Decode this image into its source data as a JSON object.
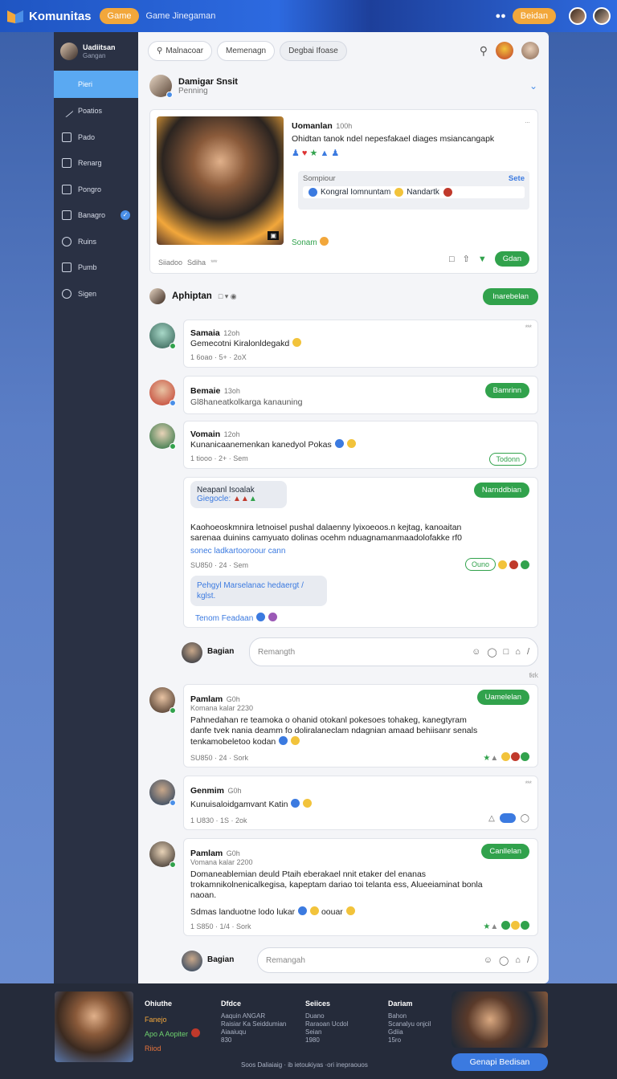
{
  "topbar": {
    "brand": "Komunitas",
    "game_pill": "Game",
    "link": "Game Jinegaman",
    "action_pill": "Beidan"
  },
  "sidebar": {
    "user_name": "Uadiitsan",
    "user_sub": "Gangan",
    "items": [
      {
        "label": "Pieri",
        "icon": "home-icon"
      },
      {
        "label": "Poatios",
        "icon": "pencil-icon"
      },
      {
        "label": "Pado",
        "icon": "document-icon"
      },
      {
        "label": "Renarg",
        "icon": "checkbox-icon"
      },
      {
        "label": "Pongro",
        "icon": "edit-icon"
      },
      {
        "label": "Banagro",
        "icon": "media-icon"
      },
      {
        "label": "Ruins",
        "icon": "group-icon"
      },
      {
        "label": "Pumb",
        "icon": "pen-icon"
      },
      {
        "label": "Sigen",
        "icon": "settings-icon"
      }
    ]
  },
  "main": {
    "search_label": "Malnacoar",
    "chip_1": "Memenagn",
    "chip_2": "Degbai Ifoase",
    "post": {
      "author": "Damigar Snsit",
      "sub": "Penning",
      "inner_author": "Uomanlan",
      "inner_time": "100h",
      "inner_text": "Ohidtan tanok ndel nepesfakael diages msiancangapk",
      "quote_label": "Sompiour",
      "quote_action": "Sete",
      "quote_text": "Kongral Iomnuntam",
      "quote_name": "Nandartk",
      "green_label": "Sonam",
      "stats": "Siiadoo",
      "stats_2": "Sdiha",
      "action_btn": "Gdan"
    },
    "section": {
      "title": "Aphiptan",
      "btn": "Inarebelan"
    },
    "comments": [
      {
        "name": "Samaia",
        "time": "12oh",
        "text": "Gemecotni Kiralonldegakd",
        "stats": "1 6oao · 5+ · 2oX"
      },
      {
        "name": "Bemaie",
        "time": "13oh",
        "text": "Gl8haneatkolkarga kanauning",
        "btn": "Bamrinn"
      },
      {
        "name": "Vomain",
        "time": "12oh",
        "text": "Kunanicaanemenkan kanedyol Pokas",
        "stats": "1 tiooo · 2+ · Sem",
        "btn": "Todonn"
      },
      {
        "name": "Neapanl Isoalak",
        "line2": "Giegocle:",
        "btn": "Narnddbian",
        "text": "Kaohoeoskmnira letnoisel pushal dalaenny lyixoeoos.n kejtag, kanoaitan sarenaa duinins camyuato dolinas ocehm nduagnamanmaadolofakke rf0",
        "link": "sonec ladkartooroour cann",
        "stats": "SU850 · 24 · Sem",
        "btn2": "Ouno",
        "bubble": "Pehgyl Marselanac hedaergt / kglst.",
        "foot": "Tenom Feadaan"
      }
    ],
    "reply_1": {
      "name": "Bagian",
      "placeholder": "Remangth",
      "stat": "tkrk"
    },
    "comments_2": [
      {
        "name": "Pamlam",
        "time": "G0h",
        "sub": "Komana kalar 2230",
        "text": "Pahnedahan re teamoka o ohanid otokanl pokesoes tohakeg, kanegtyram danfe tvek nania deamm fo doliralaneclam ndagnian amaad behiisanr senals tenkamobeletoo kodan",
        "stats": "SU850 · 24 · Sork",
        "btn": "Uamelelan"
      },
      {
        "name": "Genmim",
        "time": "G0h",
        "text": "Kunuisaloidgamvant Katin",
        "stats": "1 U830 · 1S · 2ok"
      },
      {
        "name": "Pamlam",
        "time": "G0h",
        "sub": "Vomana kalar 2200",
        "text": "Domaneablemian deuld Ptaih eberakael nnit etaker del enanas trokamnikolnenicalkegisa, kapeptam dariao toi telanta ess, Alueeiaminat bonla naoan.",
        "text2": "Sdmas landuotne lodo lukar",
        "text3": "oouar",
        "stats": "1 S850 · 1/4 · Sork",
        "btn": "Canllelan"
      }
    ],
    "reply_2": {
      "name": "Bagian",
      "placeholder": "Remangah"
    }
  },
  "footer": {
    "promo_1": "Ohiuthe",
    "promo_2": "Fanejo",
    "promo_3": "Apo A Aopiter",
    "promo_4": "Riiod",
    "cols": [
      {
        "h": "Dfdce",
        "l": [
          "Aaquin ANGAR",
          "Raisiar Ka Seiddumian",
          "Aiaaiuqu",
          "830"
        ]
      },
      {
        "h": "Seiices",
        "l": [
          "Duano",
          "Raraoan Ucdol",
          "Seian",
          "1980"
        ]
      },
      {
        "h": "Dariam",
        "l": [
          "Bahon",
          "Scanalyu onjcil",
          "Gdiia",
          "15ro"
        ]
      }
    ],
    "copy": "Soos Daliaiaig · ib ietoukiyas ·ori inepraouos",
    "cta": "Genapi Bedisan"
  }
}
